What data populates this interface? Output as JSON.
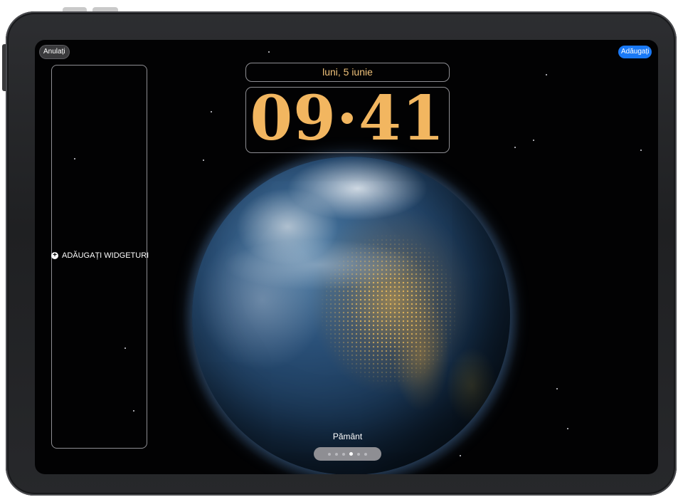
{
  "top_bar": {
    "cancel_label": "Anulați",
    "add_label": "Adăugați"
  },
  "widgets": {
    "add_label": "ADĂUGAȚI WIDGETURI"
  },
  "lock_screen": {
    "date": "luni, 5 iunie",
    "time": "09·41",
    "wallpaper_name": "Pământ"
  },
  "pager": {
    "count": 6,
    "active_index": 3
  },
  "colors": {
    "accent_button": "#1a79f5",
    "clock": "#f2b660",
    "date": "#f0c27a"
  }
}
